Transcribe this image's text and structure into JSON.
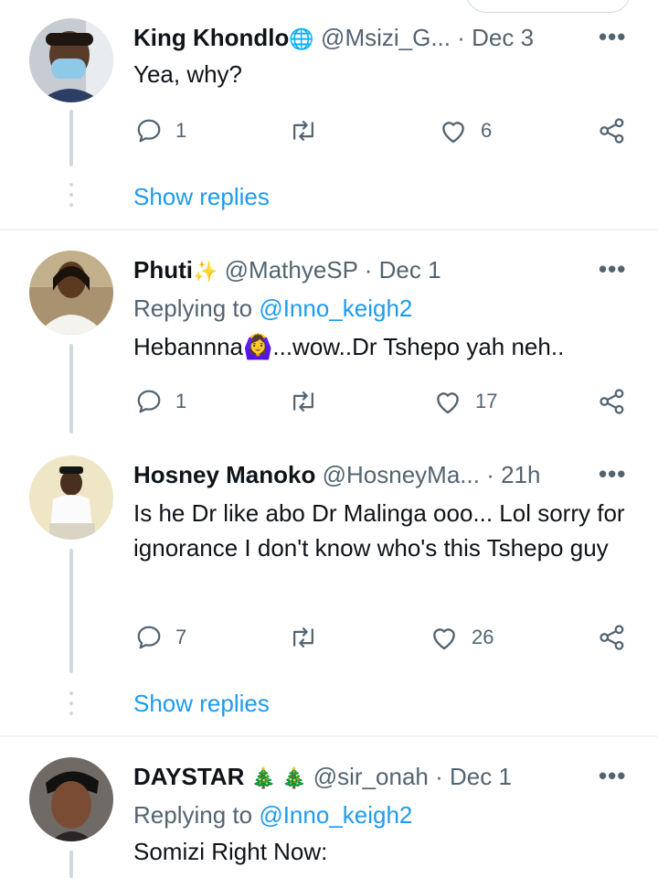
{
  "tweets": [
    {
      "name": "King Khondlo",
      "name_emoji": "🌐",
      "handle": "@Msizi_G...",
      "time": "Dec 3",
      "text": "Yea, why?",
      "replies": "1",
      "retweets": "",
      "likes": "6",
      "show_replies": "Show replies"
    },
    {
      "name": "Phuti",
      "name_emoji": "✨",
      "handle": "@MathyeSP",
      "time": "Dec 1",
      "replying_prefix": "Replying to ",
      "replying_to": "@Inno_keigh2",
      "text": "Hebannna🙆‍♀️...wow..Dr Tshepo yah neh..",
      "replies": "1",
      "retweets": "",
      "likes": "17"
    },
    {
      "name": "Hosney Manoko",
      "handle": "@HosneyMa...",
      "time": "21h",
      "text": "Is he Dr like abo Dr Malinga ooo... Lol sorry for ignorance I don't know who's this Tshepo guy",
      "replies": "7",
      "retweets": "",
      "likes": "26",
      "show_replies": "Show replies"
    },
    {
      "name": "DAYSTAR",
      "name_emoji": "🎄 🎄",
      "handle": "@sir_onah",
      "time": "Dec 1",
      "replying_prefix": "Replying to ",
      "replying_to": "@Inno_keigh2",
      "text": "Somizi Right Now:"
    }
  ],
  "ui": {
    "separator": "·",
    "more": "•••"
  },
  "icons": {
    "reply": "reply-icon",
    "retweet": "retweet-icon",
    "like": "heart-icon",
    "share": "share-icon",
    "more": "more-icon"
  },
  "colors": {
    "text": "#0f1419",
    "secondary": "#536471",
    "link": "#1d9bf0",
    "divider": "#eff3f4",
    "thread_line": "#cfd9de"
  }
}
